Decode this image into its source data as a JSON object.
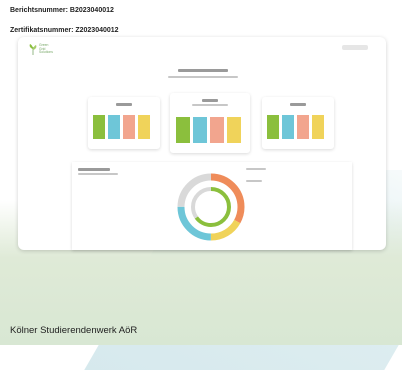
{
  "header": {
    "report_number": "Berichtsnummer: B2023040012",
    "certificate_number": "Zertifikatsnummer: Z2023040012"
  },
  "mockup": {
    "logo_text": "Green\nGrid\nSolutions",
    "colors": {
      "green": "#8bbf3d",
      "blue": "#6ec6d8",
      "salmon": "#f2a58e",
      "yellow": "#f0d35a",
      "orange": "#ef8c5a"
    },
    "donut": {
      "outer": [
        {
          "color": "#ef8c5a",
          "fraction": 0.33
        },
        {
          "color": "#f0d35a",
          "fraction": 0.17
        },
        {
          "color": "#6ec6d8",
          "fraction": 0.25
        },
        {
          "color": "#d9d9d9",
          "fraction": 0.25
        }
      ],
      "inner": [
        {
          "color": "#8bbf3d",
          "fraction": 0.65
        },
        {
          "color": "#d9d9d9",
          "fraction": 0.35
        }
      ]
    }
  },
  "footer": {
    "organization": "Kölner Studierendenwerk AöR"
  }
}
